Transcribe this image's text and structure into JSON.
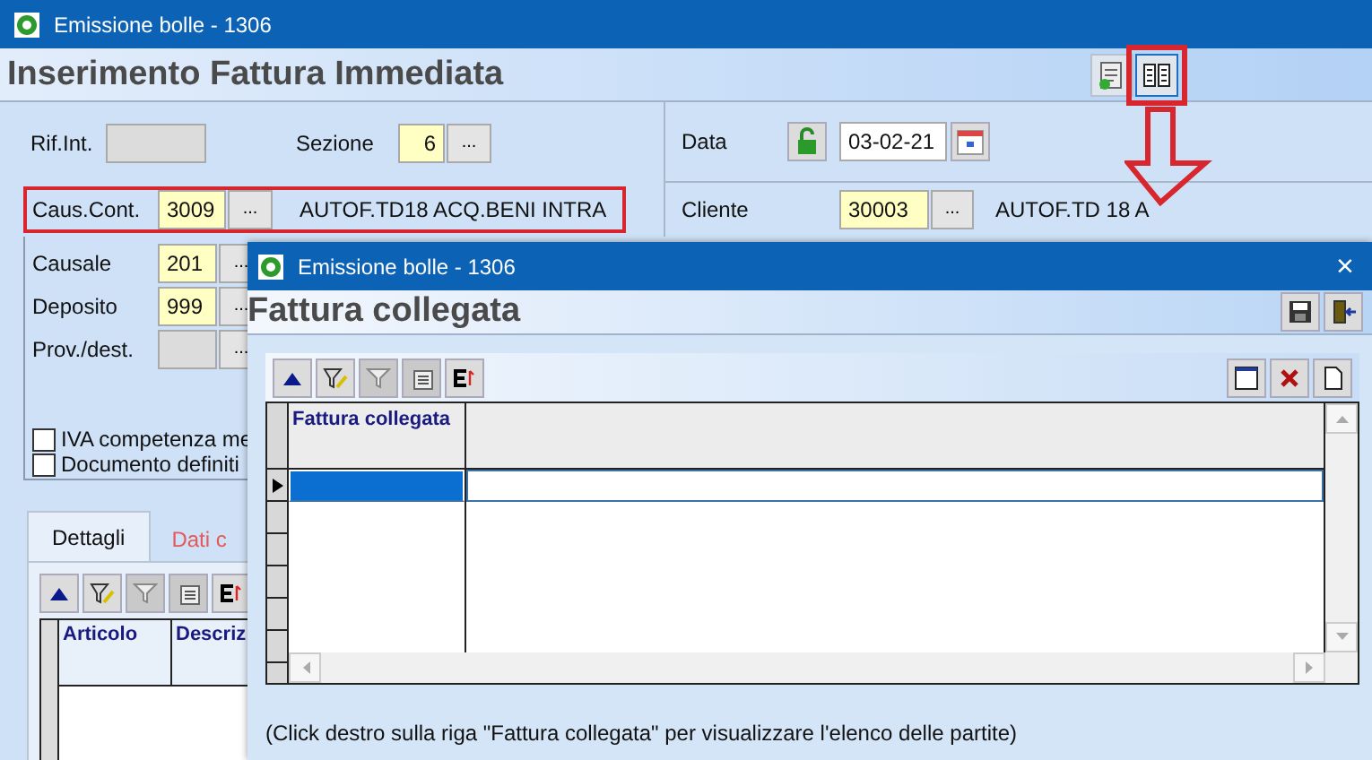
{
  "window": {
    "title": "Emissione bolle - 1306"
  },
  "header": {
    "title": "Inserimento Fattura Immediata",
    "toolbar": [
      {
        "kind": "clipboard",
        "highlighted": false
      },
      {
        "kind": "columns",
        "highlighted": true
      }
    ]
  },
  "form": {
    "rif_int": {
      "label": "Rif.Int."
    },
    "sezione": {
      "label": "Sezione",
      "value": "6",
      "lookup": "..."
    },
    "data": {
      "label": "Data",
      "value": "03-02-21"
    },
    "caus_cont": {
      "label": "Caus.Cont.",
      "value": "3009",
      "lookup": "...",
      "description": "AUTOF.TD18 ACQ.BENI INTRA",
      "highlighted": true
    },
    "cliente": {
      "label": "Cliente",
      "value": "30003",
      "lookup": "...",
      "description": "AUTOF.TD 18 A"
    },
    "rows": [
      {
        "label": "Causale",
        "value": "201",
        "lookup": "..."
      },
      {
        "label": "Deposito",
        "value": "999",
        "lookup": "..."
      },
      {
        "label": "Prov./dest.",
        "lookup": "..."
      }
    ],
    "checkboxes": [
      {
        "label": "IVA competenza me",
        "checked": false
      },
      {
        "label": "Documento definiti",
        "checked": false
      }
    ]
  },
  "tabs": [
    {
      "label": "Dettagli",
      "selected": true
    },
    {
      "label": "Dati c",
      "selected": false
    }
  ],
  "details_grid": {
    "columns": [
      "Articolo",
      "Descriz"
    ]
  },
  "dialog": {
    "title": "Emissione bolle - 1306",
    "close": "×",
    "heading": "Fattura collegata",
    "grid": {
      "columns": [
        "Fattura collegata"
      ],
      "rows": [
        {
          "selected": true
        },
        {
          "selected": false
        },
        {
          "selected": false
        },
        {
          "selected": false
        },
        {
          "selected": false
        },
        {
          "selected": false
        }
      ]
    },
    "note": "(Click destro sulla riga \"Fattura collegata\" per visualizzare l'elenco delle partite)"
  }
}
